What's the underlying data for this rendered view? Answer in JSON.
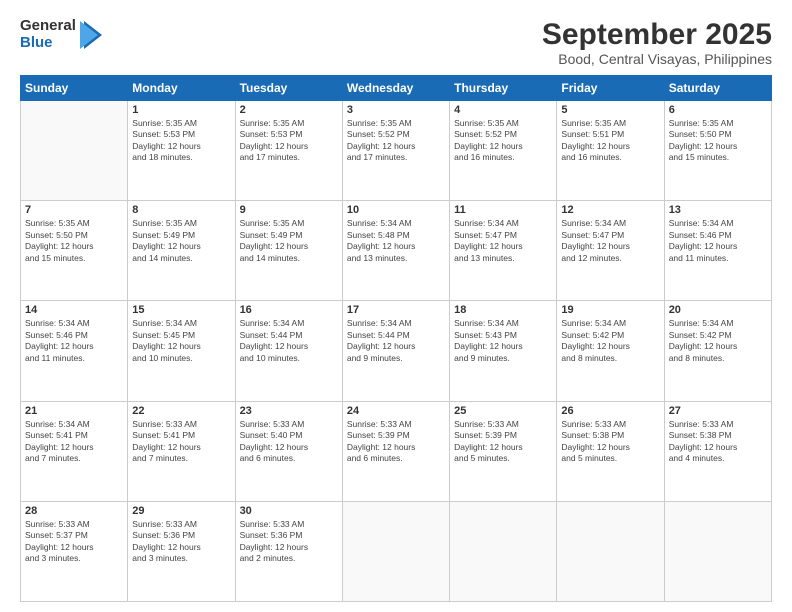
{
  "header": {
    "logo_general": "General",
    "logo_blue": "Blue",
    "title": "September 2025",
    "location": "Bood, Central Visayas, Philippines"
  },
  "calendar": {
    "days_of_week": [
      "Sunday",
      "Monday",
      "Tuesday",
      "Wednesday",
      "Thursday",
      "Friday",
      "Saturday"
    ],
    "weeks": [
      [
        {
          "day": "",
          "info": ""
        },
        {
          "day": "1",
          "info": "Sunrise: 5:35 AM\nSunset: 5:53 PM\nDaylight: 12 hours\nand 18 minutes."
        },
        {
          "day": "2",
          "info": "Sunrise: 5:35 AM\nSunset: 5:53 PM\nDaylight: 12 hours\nand 17 minutes."
        },
        {
          "day": "3",
          "info": "Sunrise: 5:35 AM\nSunset: 5:52 PM\nDaylight: 12 hours\nand 17 minutes."
        },
        {
          "day": "4",
          "info": "Sunrise: 5:35 AM\nSunset: 5:52 PM\nDaylight: 12 hours\nand 16 minutes."
        },
        {
          "day": "5",
          "info": "Sunrise: 5:35 AM\nSunset: 5:51 PM\nDaylight: 12 hours\nand 16 minutes."
        },
        {
          "day": "6",
          "info": "Sunrise: 5:35 AM\nSunset: 5:50 PM\nDaylight: 12 hours\nand 15 minutes."
        }
      ],
      [
        {
          "day": "7",
          "info": "Sunrise: 5:35 AM\nSunset: 5:50 PM\nDaylight: 12 hours\nand 15 minutes."
        },
        {
          "day": "8",
          "info": "Sunrise: 5:35 AM\nSunset: 5:49 PM\nDaylight: 12 hours\nand 14 minutes."
        },
        {
          "day": "9",
          "info": "Sunrise: 5:35 AM\nSunset: 5:49 PM\nDaylight: 12 hours\nand 14 minutes."
        },
        {
          "day": "10",
          "info": "Sunrise: 5:34 AM\nSunset: 5:48 PM\nDaylight: 12 hours\nand 13 minutes."
        },
        {
          "day": "11",
          "info": "Sunrise: 5:34 AM\nSunset: 5:47 PM\nDaylight: 12 hours\nand 13 minutes."
        },
        {
          "day": "12",
          "info": "Sunrise: 5:34 AM\nSunset: 5:47 PM\nDaylight: 12 hours\nand 12 minutes."
        },
        {
          "day": "13",
          "info": "Sunrise: 5:34 AM\nSunset: 5:46 PM\nDaylight: 12 hours\nand 11 minutes."
        }
      ],
      [
        {
          "day": "14",
          "info": "Sunrise: 5:34 AM\nSunset: 5:46 PM\nDaylight: 12 hours\nand 11 minutes."
        },
        {
          "day": "15",
          "info": "Sunrise: 5:34 AM\nSunset: 5:45 PM\nDaylight: 12 hours\nand 10 minutes."
        },
        {
          "day": "16",
          "info": "Sunrise: 5:34 AM\nSunset: 5:44 PM\nDaylight: 12 hours\nand 10 minutes."
        },
        {
          "day": "17",
          "info": "Sunrise: 5:34 AM\nSunset: 5:44 PM\nDaylight: 12 hours\nand 9 minutes."
        },
        {
          "day": "18",
          "info": "Sunrise: 5:34 AM\nSunset: 5:43 PM\nDaylight: 12 hours\nand 9 minutes."
        },
        {
          "day": "19",
          "info": "Sunrise: 5:34 AM\nSunset: 5:42 PM\nDaylight: 12 hours\nand 8 minutes."
        },
        {
          "day": "20",
          "info": "Sunrise: 5:34 AM\nSunset: 5:42 PM\nDaylight: 12 hours\nand 8 minutes."
        }
      ],
      [
        {
          "day": "21",
          "info": "Sunrise: 5:34 AM\nSunset: 5:41 PM\nDaylight: 12 hours\nand 7 minutes."
        },
        {
          "day": "22",
          "info": "Sunrise: 5:33 AM\nSunset: 5:41 PM\nDaylight: 12 hours\nand 7 minutes."
        },
        {
          "day": "23",
          "info": "Sunrise: 5:33 AM\nSunset: 5:40 PM\nDaylight: 12 hours\nand 6 minutes."
        },
        {
          "day": "24",
          "info": "Sunrise: 5:33 AM\nSunset: 5:39 PM\nDaylight: 12 hours\nand 6 minutes."
        },
        {
          "day": "25",
          "info": "Sunrise: 5:33 AM\nSunset: 5:39 PM\nDaylight: 12 hours\nand 5 minutes."
        },
        {
          "day": "26",
          "info": "Sunrise: 5:33 AM\nSunset: 5:38 PM\nDaylight: 12 hours\nand 5 minutes."
        },
        {
          "day": "27",
          "info": "Sunrise: 5:33 AM\nSunset: 5:38 PM\nDaylight: 12 hours\nand 4 minutes."
        }
      ],
      [
        {
          "day": "28",
          "info": "Sunrise: 5:33 AM\nSunset: 5:37 PM\nDaylight: 12 hours\nand 3 minutes."
        },
        {
          "day": "29",
          "info": "Sunrise: 5:33 AM\nSunset: 5:36 PM\nDaylight: 12 hours\nand 3 minutes."
        },
        {
          "day": "30",
          "info": "Sunrise: 5:33 AM\nSunset: 5:36 PM\nDaylight: 12 hours\nand 2 minutes."
        },
        {
          "day": "",
          "info": ""
        },
        {
          "day": "",
          "info": ""
        },
        {
          "day": "",
          "info": ""
        },
        {
          "day": "",
          "info": ""
        }
      ]
    ]
  }
}
